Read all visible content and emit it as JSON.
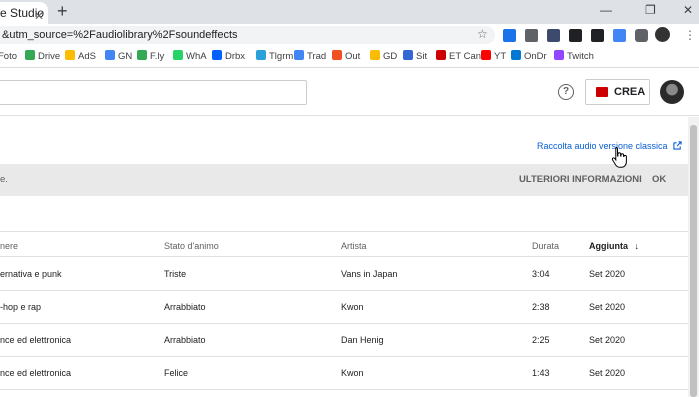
{
  "browser": {
    "tab_title": "e Studio",
    "url": "&utm_source=%2Faudiolibrary%2Fsoundeffects"
  },
  "bookmarks": [
    {
      "label": "Foto",
      "color": "#8ab4f8"
    },
    {
      "label": "Drive",
      "color": "#34a853"
    },
    {
      "label": "AdS",
      "color": "#fbbc04"
    },
    {
      "label": "GN",
      "color": "#4285f4"
    },
    {
      "label": "F.ly",
      "color": "#34a853"
    },
    {
      "label": "WhA",
      "color": "#25d366"
    },
    {
      "label": "Drbx",
      "color": "#0061ff"
    },
    {
      "label": "Tlgrm",
      "color": "#2aa1da"
    },
    {
      "label": "Trad",
      "color": "#4285f4"
    },
    {
      "label": "Out",
      "color": "#f25022"
    },
    {
      "label": "GD",
      "color": "#fbbc04"
    },
    {
      "label": "Sit",
      "color": "#3367d6"
    },
    {
      "label": "ET Can",
      "color": "#cc0000"
    },
    {
      "label": "YT",
      "color": "#ff0000"
    },
    {
      "label": "OnDr",
      "color": "#0078d4"
    },
    {
      "label": "Twitch",
      "color": "#9146ff"
    }
  ],
  "header": {
    "help_glyph": "?",
    "create_label": "CREA"
  },
  "content": {
    "classic_link": "Raccolta audio versione classica",
    "banner_text": "e.",
    "more_info": "ULTERIORI INFORMAZIONI",
    "ok": "OK"
  },
  "table": {
    "headers": {
      "genre": "nere",
      "mood": "Stato d'animo",
      "artist": "Artista",
      "duration": "Durata",
      "added": "Aggiunta"
    },
    "rows": [
      {
        "genre": "ernativa e punk",
        "mood": "Triste",
        "artist": "Vans in Japan",
        "duration": "3:04",
        "added": "Set 2020"
      },
      {
        "genre": "-hop e rap",
        "mood": "Arrabbiato",
        "artist": "Kwon",
        "duration": "2:38",
        "added": "Set 2020"
      },
      {
        "genre": "nce ed elettronica",
        "mood": "Arrabbiato",
        "artist": "Dan Henig",
        "duration": "2:25",
        "added": "Set 2020"
      },
      {
        "genre": "nce ed elettronica",
        "mood": "Felice",
        "artist": "Kwon",
        "duration": "1:43",
        "added": "Set 2020"
      }
    ]
  },
  "colors": {
    "accent": "#065fd4",
    "create_icon": "#cc0000"
  }
}
